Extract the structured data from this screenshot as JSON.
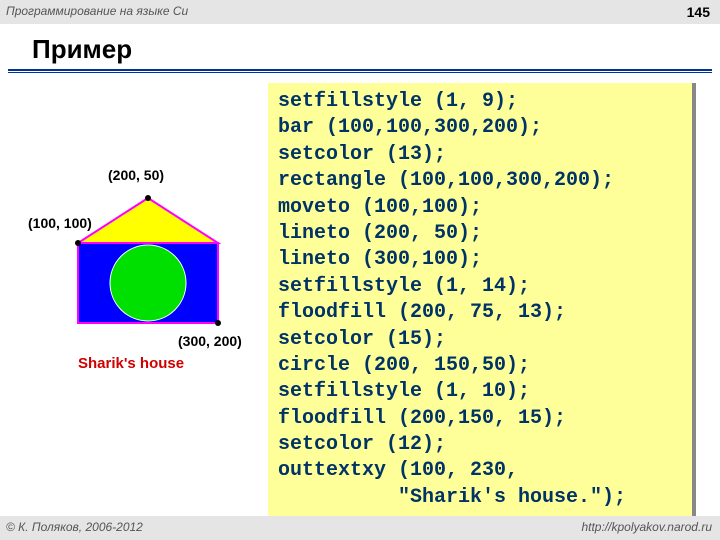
{
  "header": {
    "course": "Программирование на языке Си",
    "page": "145"
  },
  "title": "Пример",
  "figure": {
    "p1": "(100, 100)",
    "p2": "(200, 50)",
    "p3": "(300, 200)",
    "caption": "Sharik's house"
  },
  "code": "setfillstyle (1, 9);\nbar (100,100,300,200);\nsetcolor (13);\nrectangle (100,100,300,200);\nmoveto (100,100);\nlineto (200, 50);\nlineto (300,100);\nsetfillstyle (1, 14);\nfloodfill (200, 75, 13);\nsetcolor (15);\ncircle (200, 150,50);\nsetfillstyle (1, 10);\nfloodfill (200,150, 15);\nsetcolor (12);\nouttextxy (100, 230,\n          \"Sharik's house.\");",
  "footer": {
    "left": "© К. Поляков, 2006-2012",
    "right": "http://kpolyakov.narod.ru"
  }
}
